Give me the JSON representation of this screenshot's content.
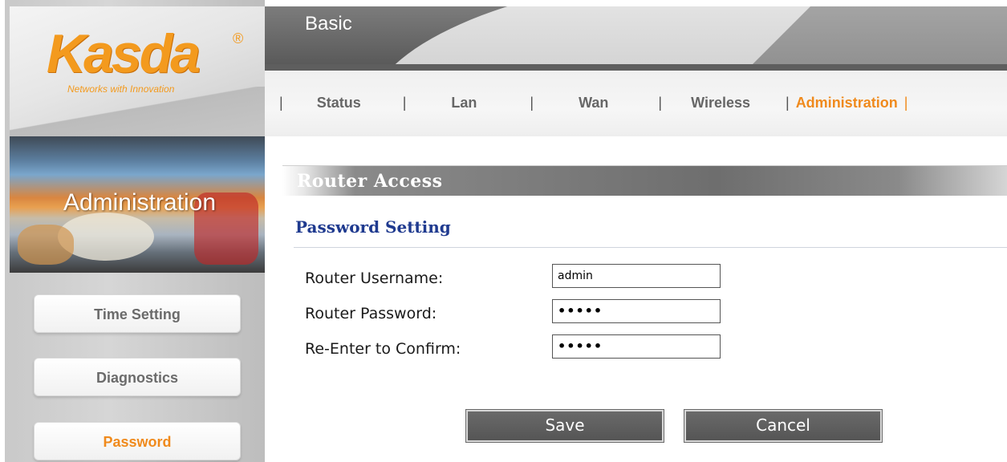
{
  "logo": {
    "brand": "Kasda",
    "registered": "®",
    "tagline": "Networks with Innovation"
  },
  "header": {
    "basic_label": "Basic"
  },
  "nav": {
    "items": [
      {
        "label": "Status"
      },
      {
        "label": "Lan"
      },
      {
        "label": "Wan"
      },
      {
        "label": "Wireless"
      },
      {
        "label": "Administration"
      }
    ],
    "separator": "|",
    "active": "Administration",
    "active_color": "#f08a1c"
  },
  "sidebar": {
    "section_title": "Administration",
    "items": [
      {
        "label": "Time Setting"
      },
      {
        "label": "Diagnostics"
      },
      {
        "label": "Password"
      }
    ],
    "active": "Password"
  },
  "main": {
    "section_bar_title": "Router Access",
    "heading": "Password Setting",
    "heading_color": "#1f3a8f",
    "fields": [
      {
        "label": "Router Username:",
        "value": "admin",
        "type": "text"
      },
      {
        "label": "Router Password:",
        "value": "•••••",
        "type": "password"
      },
      {
        "label": "Re-Enter to Confirm:",
        "value": "•••••",
        "type": "password"
      }
    ],
    "buttons": {
      "save": "Save",
      "cancel": "Cancel"
    }
  },
  "colors": {
    "accent_orange": "#f08a1c",
    "heading_blue": "#1f3a8f",
    "bar_gray": "#6e6e6e"
  }
}
